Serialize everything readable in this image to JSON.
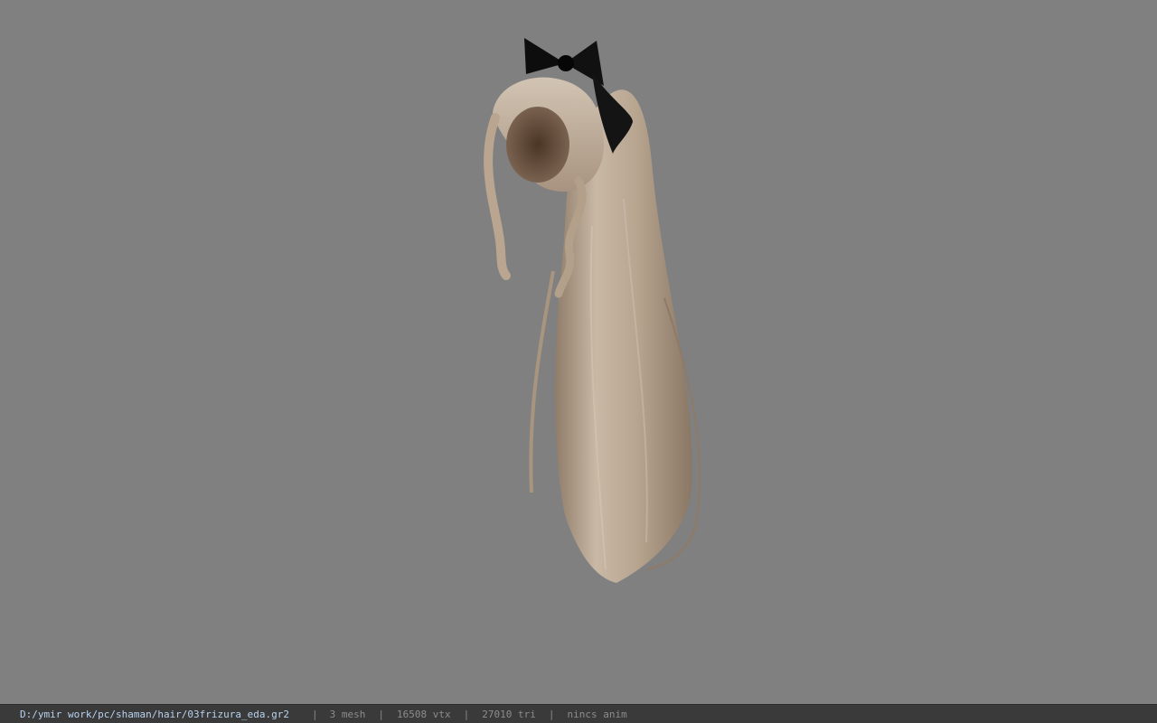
{
  "viewport": {
    "background": "#808080",
    "model": {
      "subject": "hair-ponytail-icon",
      "hair_color": "#bba995",
      "bow_color": "#0d0d0d"
    }
  },
  "statusbar": {
    "file_path": "D:/ymir work/pc/shaman/hair/03frizura_eda.gr2",
    "mesh_count": "3 mesh",
    "vertex_count": "16508 vtx",
    "triangle_count": "27010 tri",
    "anim_status": "nincs anim",
    "separator": "|"
  }
}
